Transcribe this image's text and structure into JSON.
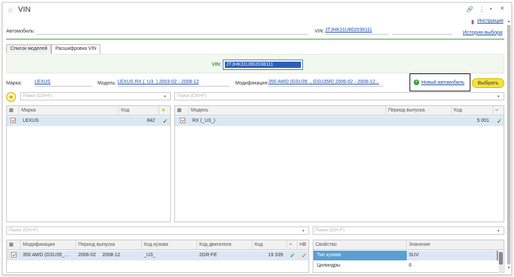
{
  "window": {
    "title": "VIN",
    "instructions_label": "Инструкция"
  },
  "top": {
    "car_label": "Автомобиль:",
    "car_value": "",
    "vin_label": "VIN:",
    "vin_value": "JTJHK31U802038111",
    "history_label": "История выбора"
  },
  "tabs": [
    {
      "label": "Список моделей"
    },
    {
      "label": "Расшифровка VIN"
    }
  ],
  "vin_panel": {
    "label": "VIN:",
    "value": "JTJHK31U802038111"
  },
  "filters": {
    "brand_label": "Марка:",
    "brand_value": "LEXUS",
    "model_label": "Модель:",
    "model_value": "LEXUS RX (_U3_) 2003-02 - 2008-12",
    "mod_label": "Модификация:",
    "mod_value": "350 AWD (GSU35_, GSU35R) 2006-02 - 2008-12...",
    "new_car_label": "Новый автомобиль",
    "choose_label": "Выбрать"
  },
  "search_placeholder": "Поиск (Ctrl+F)",
  "brand_grid": {
    "headers": [
      "Марка",
      "Код"
    ],
    "rows": [
      {
        "name": "LEXUS",
        "code": "842"
      }
    ]
  },
  "model_grid": {
    "headers": [
      "Модель",
      "Период выпуска",
      "Код"
    ],
    "rows": [
      {
        "name": "RX (_U3_)",
        "period": "",
        "code": "5 001"
      }
    ]
  },
  "mod_grid": {
    "headers": [
      "Модификация",
      "Период выпуска",
      "Код кузова",
      "Код двигателя",
      "Код",
      "НВ"
    ],
    "rows": [
      {
        "name": "350 AWD (GSU35_...",
        "from": "2006-02",
        "to": "2008-12",
        "body": "_U3_",
        "engine": "2GR-FE",
        "code": "19 339"
      }
    ]
  },
  "prop_grid": {
    "headers": [
      "Свойство",
      "Значение"
    ],
    "rows": [
      {
        "prop": "Тип кузова",
        "value": "SUV"
      },
      {
        "prop": "Цилиндры",
        "value": "6"
      }
    ]
  },
  "colors": {
    "accent_green": "#3a9b3a",
    "link_blue": "#1a4aa8",
    "selected_row": "#dbe8f4",
    "button_yellow": "#f7e13c"
  }
}
